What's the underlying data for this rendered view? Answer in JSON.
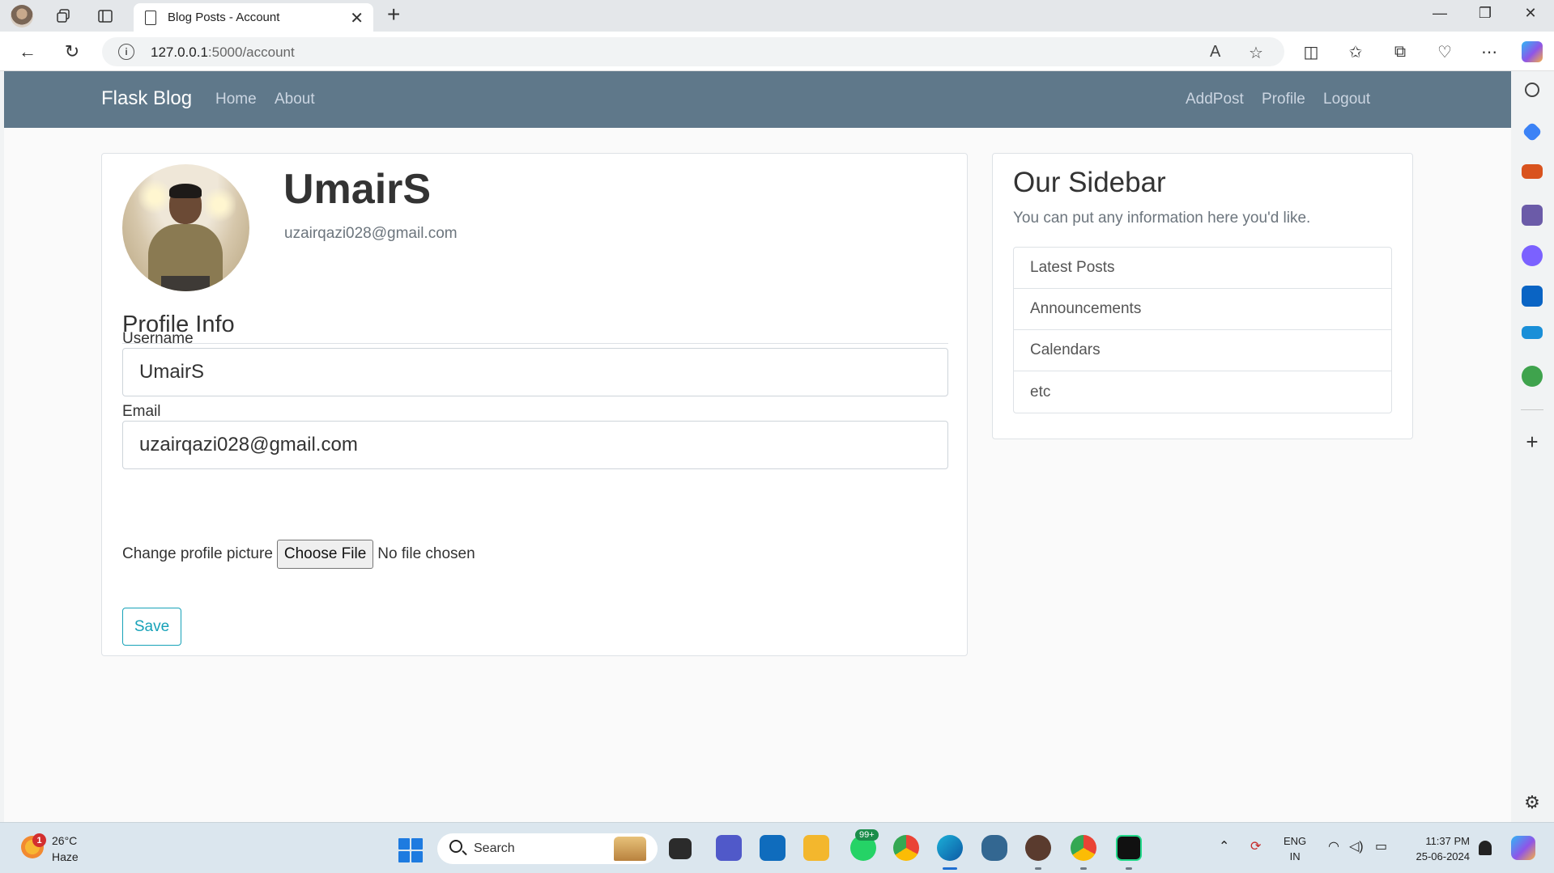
{
  "browser": {
    "tab_title": "Blog Posts - Account",
    "url_host": "127.0.0.1",
    "url_rest": ":5000/account"
  },
  "site": {
    "brand": "Flask Blog",
    "nav_left": [
      "Home",
      "About"
    ],
    "nav_right": [
      "AddPost",
      "Profile",
      "Logout"
    ]
  },
  "account": {
    "username": "UmairS",
    "email": "uzairqazi028@gmail.com",
    "avatar_icon": "user-photo"
  },
  "form": {
    "legend": "Profile Info",
    "username_label": "Username",
    "username_value": "UmairS",
    "email_label": "Email",
    "email_value": "uzairqazi028@gmail.com",
    "picture_label": "Change profile picture",
    "file_button": "Choose File",
    "file_status": "No file chosen",
    "submit_label": "Save"
  },
  "sidebar": {
    "title": "Our Sidebar",
    "subtitle": "You can put any information here you'd like.",
    "items": [
      "Latest Posts",
      "Announcements",
      "Calendars",
      "etc"
    ]
  },
  "taskbar": {
    "weather_badge": "1",
    "temperature": "26°C",
    "condition": "Haze",
    "search_placeholder": "Search",
    "whatsapp_badge": "99+",
    "lang_top": "ENG",
    "lang_bottom": "IN",
    "time": "11:37 PM",
    "date": "25-06-2024"
  },
  "colors": {
    "navbar": "#5f788a",
    "accent_info": "#17a2b8",
    "page_bg": "#fafafa"
  }
}
